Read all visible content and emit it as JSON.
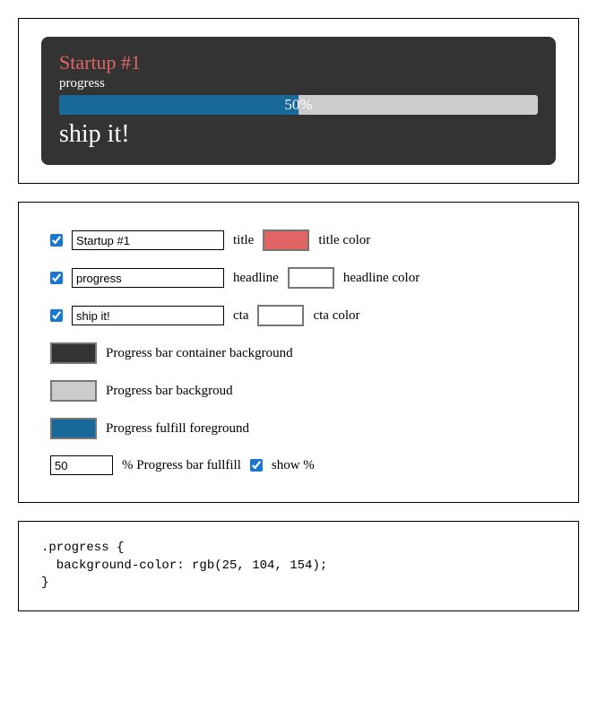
{
  "preview": {
    "title": "Startup #1",
    "headline": "progress",
    "cta": "ship it!",
    "percent_label": "50%",
    "percent_value": 50
  },
  "controls": {
    "title_checked": true,
    "title_value": "Startup #1",
    "title_label": "title",
    "title_color": "#e16464",
    "title_color_label": "title color",
    "headline_checked": true,
    "headline_value": "progress",
    "headline_label": "headline",
    "headline_color": "#ffffff",
    "headline_color_label": "headline color",
    "cta_checked": true,
    "cta_value": "ship it!",
    "cta_label": "cta",
    "cta_color": "#ffffff",
    "cta_color_label": "cta color",
    "container_bg": "#333333",
    "container_bg_label": "Progress bar container background",
    "bar_bg": "#cccccc",
    "bar_bg_label": "Progress bar backgroud",
    "fill_fg": "#19689a",
    "fill_fg_label": "Progress fulfill foreground",
    "percent_value": "50",
    "percent_label": "% Progress bar fullfill",
    "show_percent_checked": true,
    "show_percent_label": "show %"
  },
  "code": ".progress {\n  background-color: rgb(25, 104, 154);\n}"
}
